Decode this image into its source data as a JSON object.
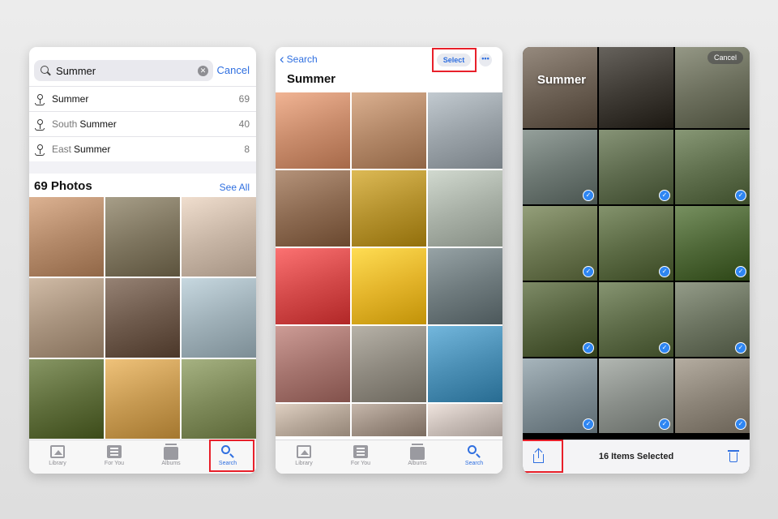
{
  "colors": {
    "accent": "#2f6fe0",
    "highlight": "#e8202a",
    "check": "#2f86f2"
  },
  "screen1": {
    "search_value": "Summer",
    "cancel_label": "Cancel",
    "suggestions": [
      {
        "prefix": "",
        "label": "Summer",
        "count": "69"
      },
      {
        "prefix": "South",
        "label": "Summer",
        "count": "40"
      },
      {
        "prefix": "East",
        "label": "Summer",
        "count": "8"
      }
    ],
    "section_title": "69 Photos",
    "see_all_label": "See All",
    "photos": [
      "#b48a6a",
      "#7f7660",
      "#c8b6a6",
      "#a8937e",
      "#6e5a4c",
      "#9fb0b8",
      "#5f6e3c",
      "#c79a52",
      "#7e8a5a"
    ]
  },
  "tabs": {
    "library": "Library",
    "for_you": "For You",
    "albums": "Albums",
    "search": "Search"
  },
  "screen2": {
    "back_label": "Search",
    "select_label": "Select",
    "more_label": "•••",
    "title": "Summer",
    "photos": [
      "#c98c6c",
      "#b38868",
      "#9aa2a8",
      "#8d6b52",
      "#b5922e",
      "#a9b1a7",
      "#d44a4a",
      "#e4b52b",
      "#6f7b7e",
      "#a5746e",
      "#8f8a80",
      "#4b8fb5",
      "#b7a89a",
      "#9e8f83",
      "#c7bcb6"
    ]
  },
  "screen3": {
    "title": "Summer",
    "cancel_label": "Cancel",
    "selected_label": "16 Items Selected",
    "photos": [
      {
        "color": "#6e6256",
        "checked": false
      },
      {
        "color": "#3f3b35",
        "checked": false
      },
      {
        "color": "#6d705e",
        "checked": false
      },
      {
        "color": "#6d7873",
        "checked": true
      },
      {
        "color": "#5f6c4f",
        "checked": true
      },
      {
        "color": "#60704e",
        "checked": true
      },
      {
        "color": "#6c7752",
        "checked": true
      },
      {
        "color": "#5c6b45",
        "checked": true
      },
      {
        "color": "#4f6838",
        "checked": true
      },
      {
        "color": "#56633f",
        "checked": true
      },
      {
        "color": "#5f6d4a",
        "checked": true
      },
      {
        "color": "#6c7461",
        "checked": true
      },
      {
        "color": "#7f8d94",
        "checked": true
      },
      {
        "color": "#8a8f8a",
        "checked": true
      },
      {
        "color": "#8d8579",
        "checked": true
      }
    ]
  }
}
